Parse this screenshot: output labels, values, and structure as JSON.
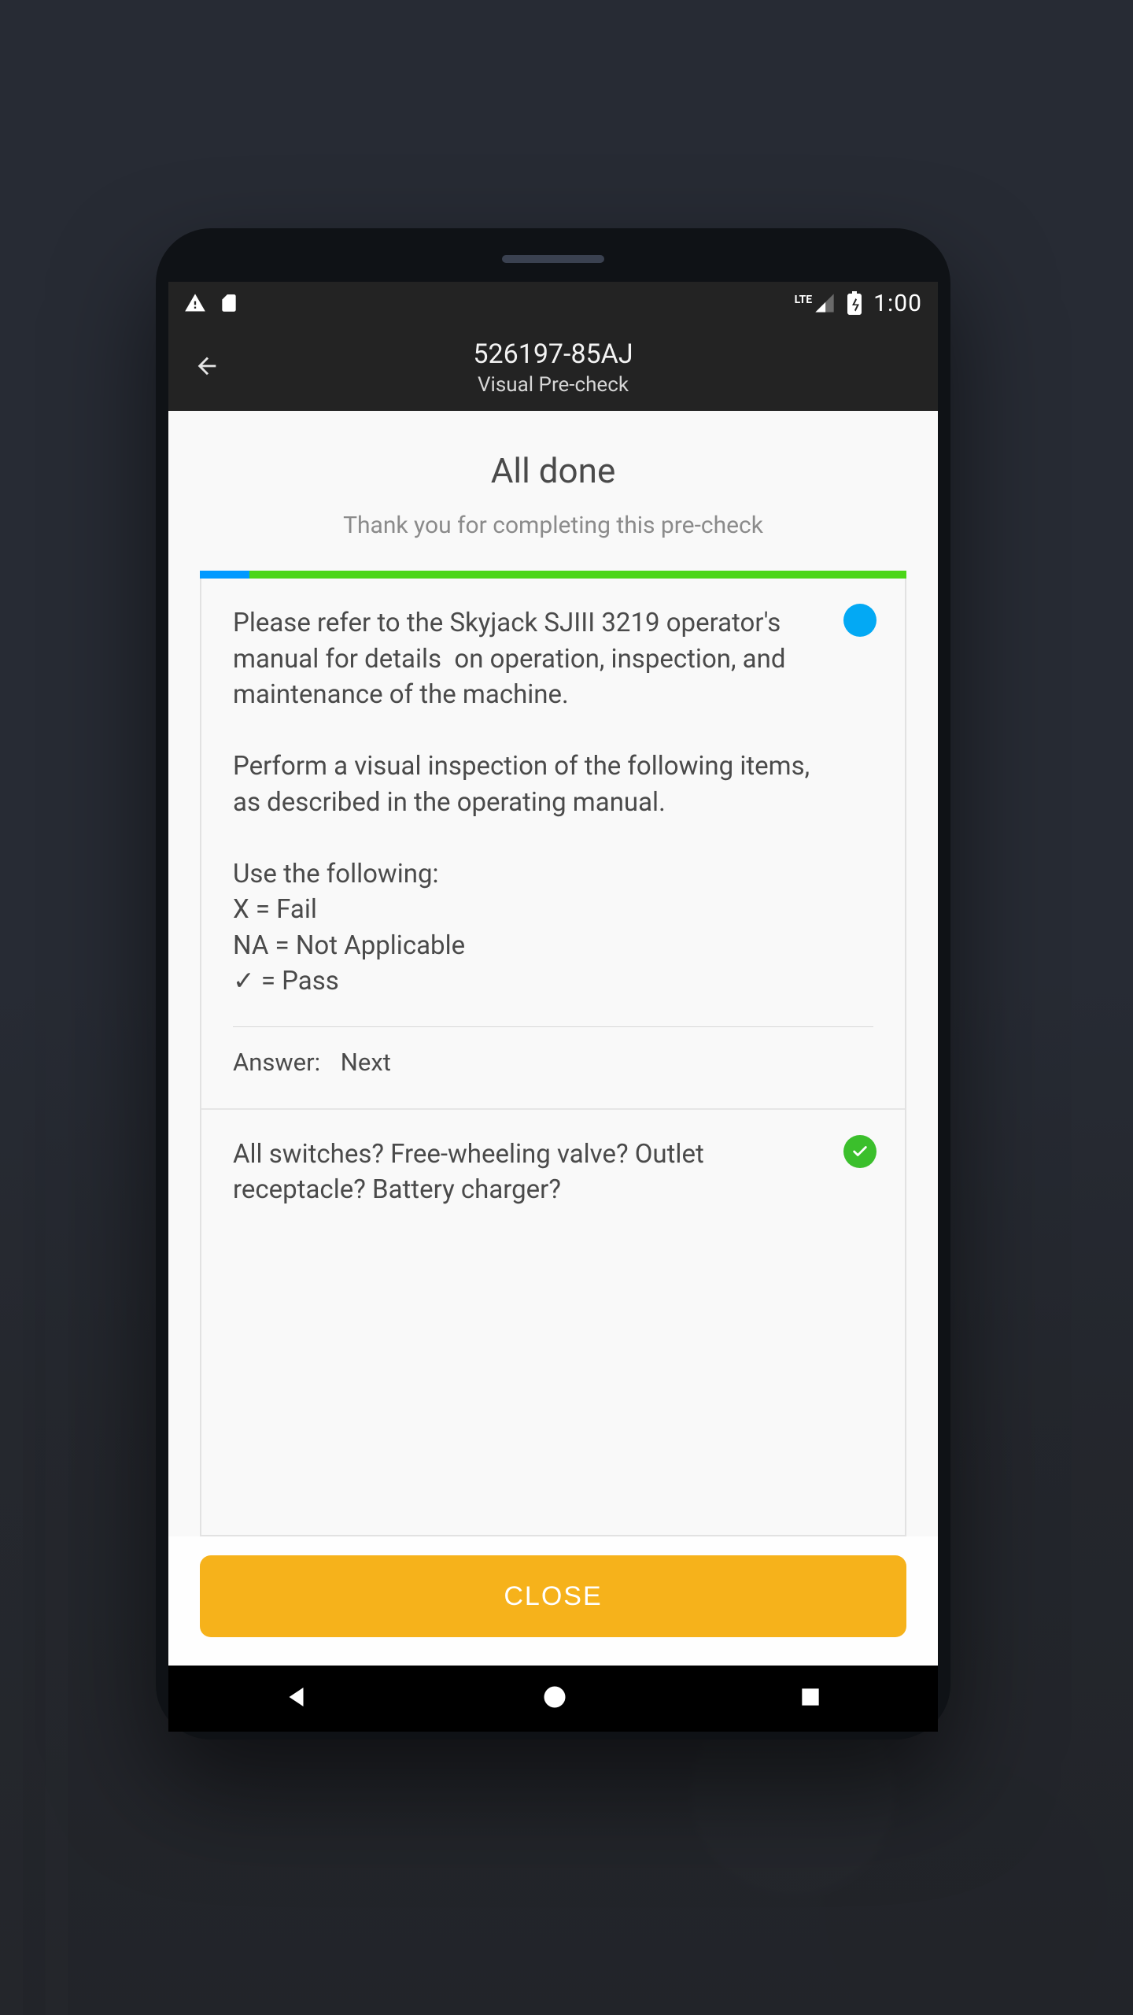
{
  "statusbar": {
    "lte": "LTE",
    "time": "1:00"
  },
  "appbar": {
    "title": "526197-85AJ",
    "subtitle": "Visual Pre-check"
  },
  "header": {
    "title": "All done",
    "subtitle": "Thank you for completing this pre-check"
  },
  "cards": {
    "card1": {
      "body": "Please refer to the Skyjack SJIII 3219 operator's manual for details  on operation, inspection, and maintenance of the machine.\n\nPerform a visual inspection of the following items, as described in the operating manual.\n\nUse the following:\nX = Fail\nNA = Not Applicable\n✓ = Pass",
      "answer_label": "Answer:",
      "answer_value": "Next"
    },
    "card2": {
      "body": "All switches? Free-wheeling valve? Outlet receptacle? Battery charger?"
    }
  },
  "footer": {
    "close": "CLOSE"
  }
}
